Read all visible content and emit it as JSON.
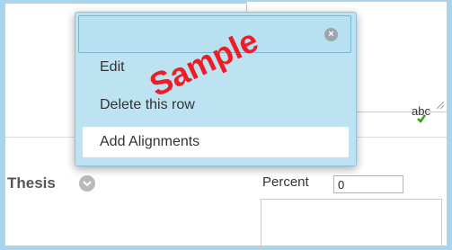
{
  "menu": {
    "search": {
      "value": "",
      "placeholder": ""
    },
    "clear_icon_glyph": "×",
    "items": [
      {
        "label": "Edit"
      },
      {
        "label": "Delete this row"
      },
      {
        "label": "Add Alignments"
      }
    ]
  },
  "spellcheck": {
    "label": "abc"
  },
  "thesis": {
    "label": "Thesis"
  },
  "percent": {
    "label": "Percent",
    "value": "0"
  },
  "watermark": {
    "text": "Sample"
  },
  "colors": {
    "frame": "#a8d4ee",
    "menu_bg": "#bde3f2",
    "watermark": "#ee1c25",
    "check": "#3a9b1c"
  }
}
